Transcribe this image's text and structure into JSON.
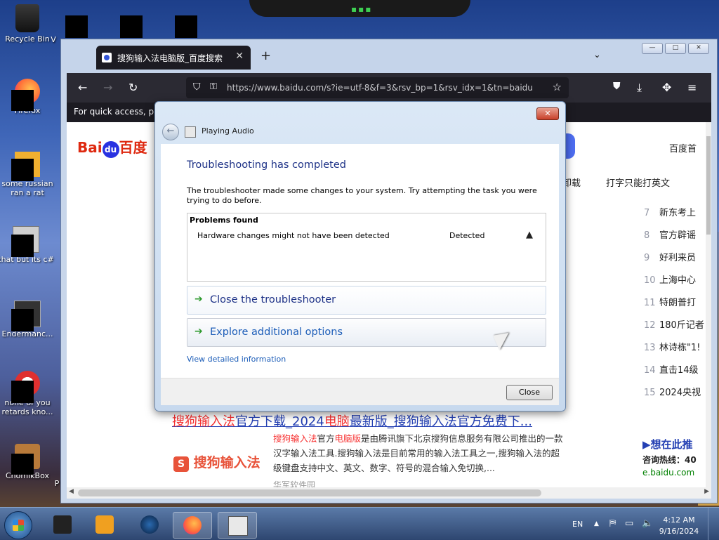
{
  "desktop": {
    "icons": [
      {
        "label": "Recycle Bin"
      },
      {
        "label": "V"
      },
      {
        "label": "Firefox"
      },
      {
        "label": "some russian ran a rat"
      },
      {
        "label": "that but its c#"
      },
      {
        "label": "Endermanc..."
      },
      {
        "label": "none of you retards kno..."
      },
      {
        "label": "ChomikBox"
      },
      {
        "label": "P"
      }
    ]
  },
  "browser": {
    "tab_title": "搜狗输入法电脑版_百度搜索",
    "url": "https://www.baidu.com/s?ie=utf-8&f=3&rsv_bp=1&rsv_idx=1&tn=baidu",
    "bookmarks_hint": "For quick access, plac",
    "window_buttons": {
      "minimize": "—",
      "maximize": "□",
      "close": "✕"
    }
  },
  "page": {
    "logo_left": "Bai",
    "logo_du": "du",
    "logo_right": "百度",
    "top_right_link": "百度首",
    "related": [
      "卸载",
      "打字只能打英文"
    ],
    "hot_list": [
      {
        "n": "7",
        "t": "新东考上"
      },
      {
        "n": "8",
        "t": "官方辟谣"
      },
      {
        "n": "9",
        "t": "好利来员"
      },
      {
        "n": "10",
        "t": "上海中心"
      },
      {
        "n": "11",
        "t": "特朗普打"
      },
      {
        "n": "12",
        "t": "180斤记者"
      },
      {
        "n": "13",
        "t": "林诗栋\"1!"
      },
      {
        "n": "14",
        "t": "直击14级"
      },
      {
        "n": "15",
        "t": "2024央视"
      }
    ],
    "result": {
      "title_red1": "搜狗输入法",
      "title_mid1": "官方下载_2024",
      "title_red2": "电脑",
      "title_mid2": "最新版_搜狗输入法官方免费下...",
      "logo_s": "S",
      "logo_text": "搜狗输入法",
      "snip_red1": "搜狗输入法",
      "snip_a": "官方",
      "snip_red2": "电脑版",
      "snip_b": "是由腾讯旗下北京搜狗信息服务有限公司推出的一款汉字输入法工具.搜狗输入法是目前常用的输入法工具之一,搜狗输入法的超级键盘支持中文、英文、数字、符号的混合输入免切换,...",
      "source": "华军软件园"
    },
    "side": {
      "link": "▶想在此推",
      "hotline": "咨询热线：40",
      "domain": "e.baidu.com"
    }
  },
  "dialog": {
    "title": "Playing Audio",
    "heading": "Troubleshooting has completed",
    "paragraph": "The troubleshooter made some changes to your system. Try attempting the task you were trying to do before.",
    "problems_header": "Problems found",
    "problem": {
      "desc": "Hardware changes might not have been detected",
      "status": "Detected"
    },
    "options": [
      "Close the troubleshooter",
      "Explore additional options"
    ],
    "details_link": "View detailed information",
    "close_button": "Close"
  },
  "taskbar": {
    "lang": "EN",
    "time": "4:12 AM",
    "date": "9/16/2024"
  }
}
